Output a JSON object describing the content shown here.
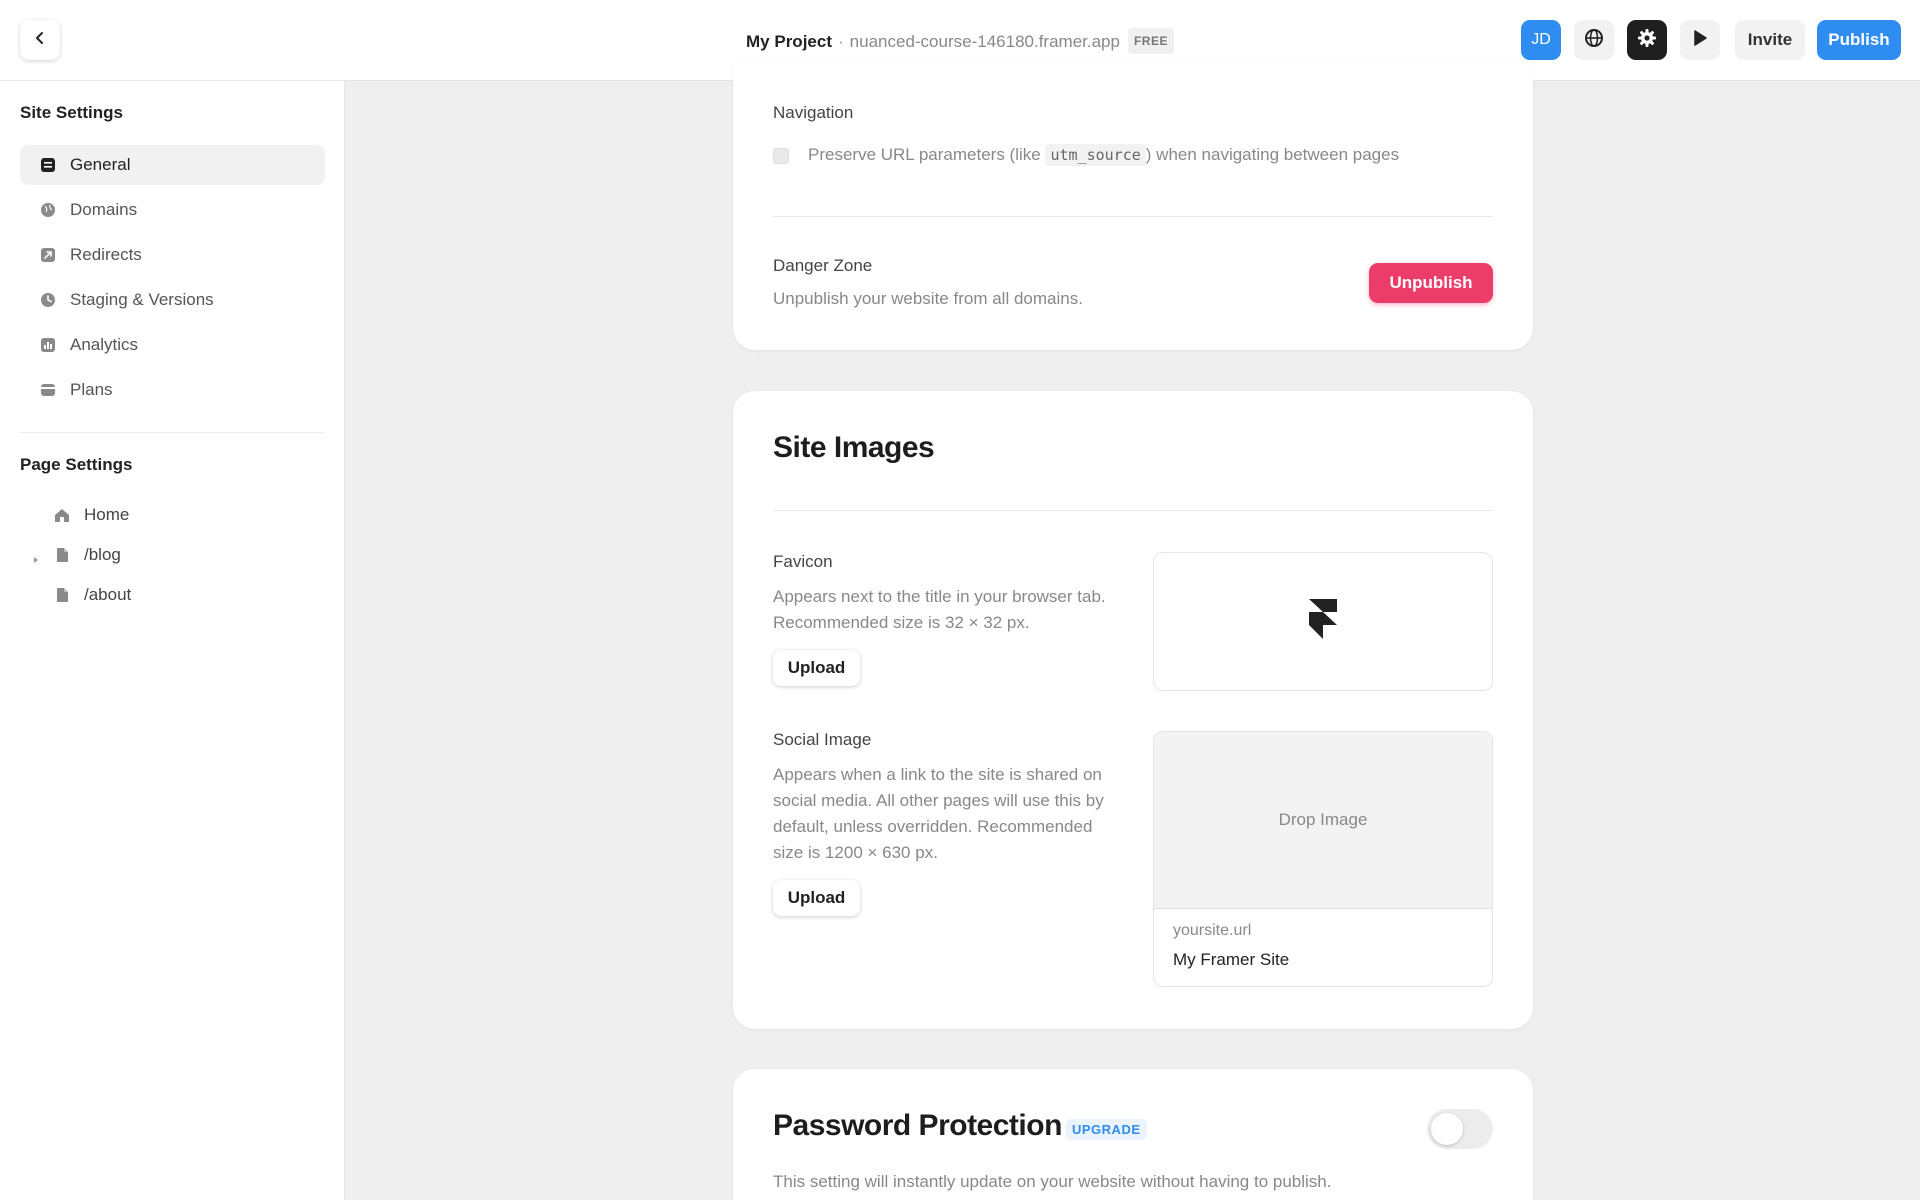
{
  "topbar": {
    "project_name": "My Project",
    "separator": "·",
    "site_url": "nuanced-course-146180.framer.app",
    "plan_badge": "FREE",
    "avatar_initials": "JD",
    "invite_label": "Invite",
    "publish_label": "Publish",
    "accent_color": "#2f8cf0"
  },
  "sidebar": {
    "site_settings_heading": "Site Settings",
    "items": [
      {
        "label": "General",
        "icon": "general-icon",
        "active": true
      },
      {
        "label": "Domains",
        "icon": "globe-icon"
      },
      {
        "label": "Redirects",
        "icon": "redirect-icon"
      },
      {
        "label": "Staging & Versions",
        "icon": "clock-icon"
      },
      {
        "label": "Analytics",
        "icon": "chart-icon"
      },
      {
        "label": "Plans",
        "icon": "card-icon"
      }
    ],
    "page_settings_heading": "Page Settings",
    "pages": [
      {
        "label": "Home",
        "icon": "home-icon"
      },
      {
        "label": "/blog",
        "icon": "file-icon",
        "expandable": true
      },
      {
        "label": "/about",
        "icon": "file-icon"
      }
    ]
  },
  "general_card": {
    "navigation_label": "Navigation",
    "preserve_text_before": "Preserve URL parameters (like",
    "preserve_code": "utm_source",
    "preserve_text_after": ") when navigating between pages",
    "danger_zone_label": "Danger Zone",
    "danger_zone_desc": "Unpublish your website from all domains.",
    "unpublish_label": "Unpublish",
    "danger_color": "#ec3d6a"
  },
  "site_images": {
    "title": "Site Images",
    "favicon_label": "Favicon",
    "favicon_desc": "Appears next to the title in your browser tab. Recommended size is 32 × 32 px.",
    "upload_label": "Upload",
    "social_label": "Social Image",
    "social_desc": "Appears when a link to the site is shared on social media. All other pages will use this by default, unless overridden. Recommended size is 1200 × 630 px.",
    "drop_image_label": "Drop Image",
    "preview_url": "yoursite.url",
    "preview_title": "My Framer Site"
  },
  "password_protection": {
    "title": "Password Protection",
    "badge": "UPGRADE",
    "desc": "This setting will instantly update on your website without having to publish.",
    "enabled": false
  }
}
